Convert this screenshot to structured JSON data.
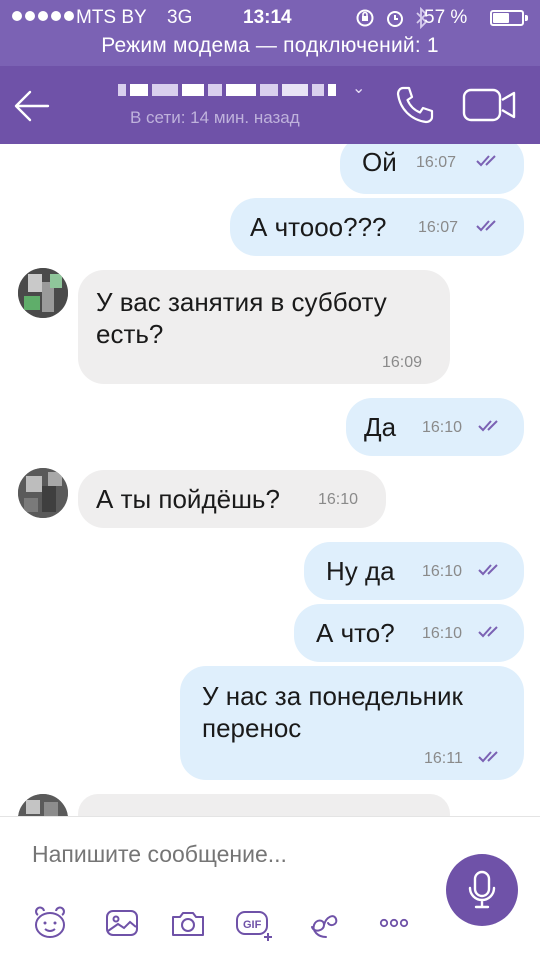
{
  "status_bar": {
    "carrier": "MTS BY",
    "network": "3G",
    "time": "13:14",
    "battery_percent": "57 %",
    "battery_level": 0.57
  },
  "hotspot_banner": "Режим модема — подключений: 1",
  "header": {
    "last_seen": "В сети: 14 мин. назад",
    "colors": {
      "primary": "#6f52a8",
      "status_bg": "#7b62b4"
    }
  },
  "messages": [
    {
      "direction": "out",
      "text": "Ой",
      "time": "16:07",
      "read": true
    },
    {
      "direction": "out",
      "text": "А чтооо???",
      "time": "16:07",
      "read": true
    },
    {
      "direction": "in",
      "text": "У вас занятия в субботу\nесть?",
      "time": "16:09"
    },
    {
      "direction": "out",
      "text": "Да",
      "time": "16:10",
      "read": true
    },
    {
      "direction": "in",
      "text": "А ты пойдёшь?",
      "time": "16:10"
    },
    {
      "direction": "out",
      "text": "Ну да",
      "time": "16:10",
      "read": true
    },
    {
      "direction": "out",
      "text": "А что?",
      "time": "16:10",
      "read": true
    },
    {
      "direction": "out",
      "text": "У нас за понедельник\nперенос",
      "time": "16:11",
      "read": true
    }
  ],
  "composer": {
    "placeholder": "Напишите сообщение...",
    "toolbar": [
      "sticker-icon",
      "gallery-icon",
      "camera-icon",
      "gif-icon",
      "doodle-icon",
      "more-icon"
    ]
  }
}
